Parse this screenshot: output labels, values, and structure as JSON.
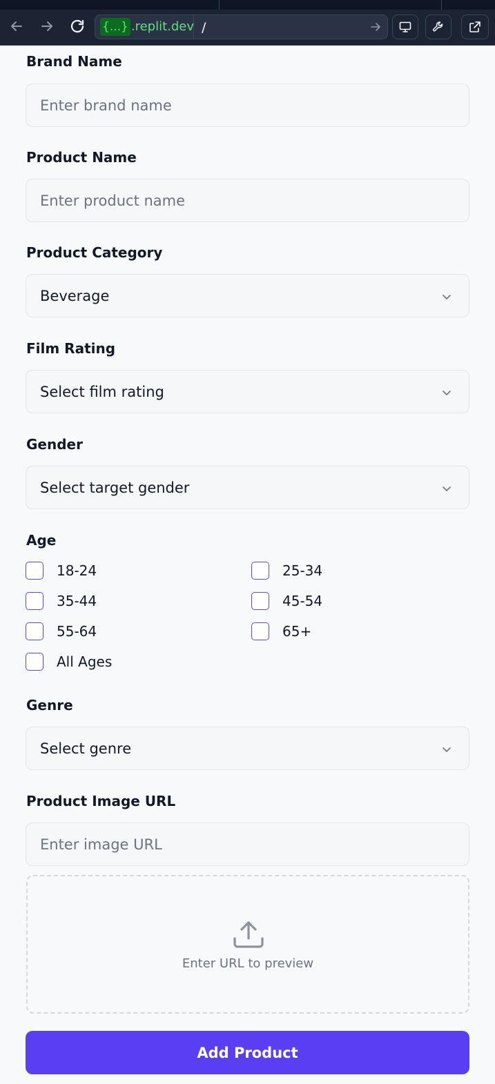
{
  "browser": {
    "url_badge": "{...}",
    "url_domain": ".replit.dev",
    "url_path": "/"
  },
  "form": {
    "brand_name": {
      "label": "Brand Name",
      "placeholder": "Enter brand name"
    },
    "product_name": {
      "label": "Product Name",
      "placeholder": "Enter product name"
    },
    "product_category": {
      "label": "Product Category",
      "value": "Beverage"
    },
    "film_rating": {
      "label": "Film Rating",
      "value": "Select film rating"
    },
    "gender": {
      "label": "Gender",
      "value": "Select target gender"
    },
    "age": {
      "label": "Age",
      "options": [
        "18-24",
        "25-34",
        "35-44",
        "45-54",
        "55-64",
        "65+",
        "All Ages"
      ]
    },
    "genre": {
      "label": "Genre",
      "value": "Select genre"
    },
    "image_url": {
      "label": "Product Image URL",
      "placeholder": "Enter image URL"
    },
    "preview_text": "Enter URL to preview",
    "submit_label": "Add Product"
  },
  "colors": {
    "accent": "#5a3ff2",
    "checkbox_border": "#5a48e6",
    "topbar": "#1c2333",
    "url_green": "#5ee07a"
  }
}
